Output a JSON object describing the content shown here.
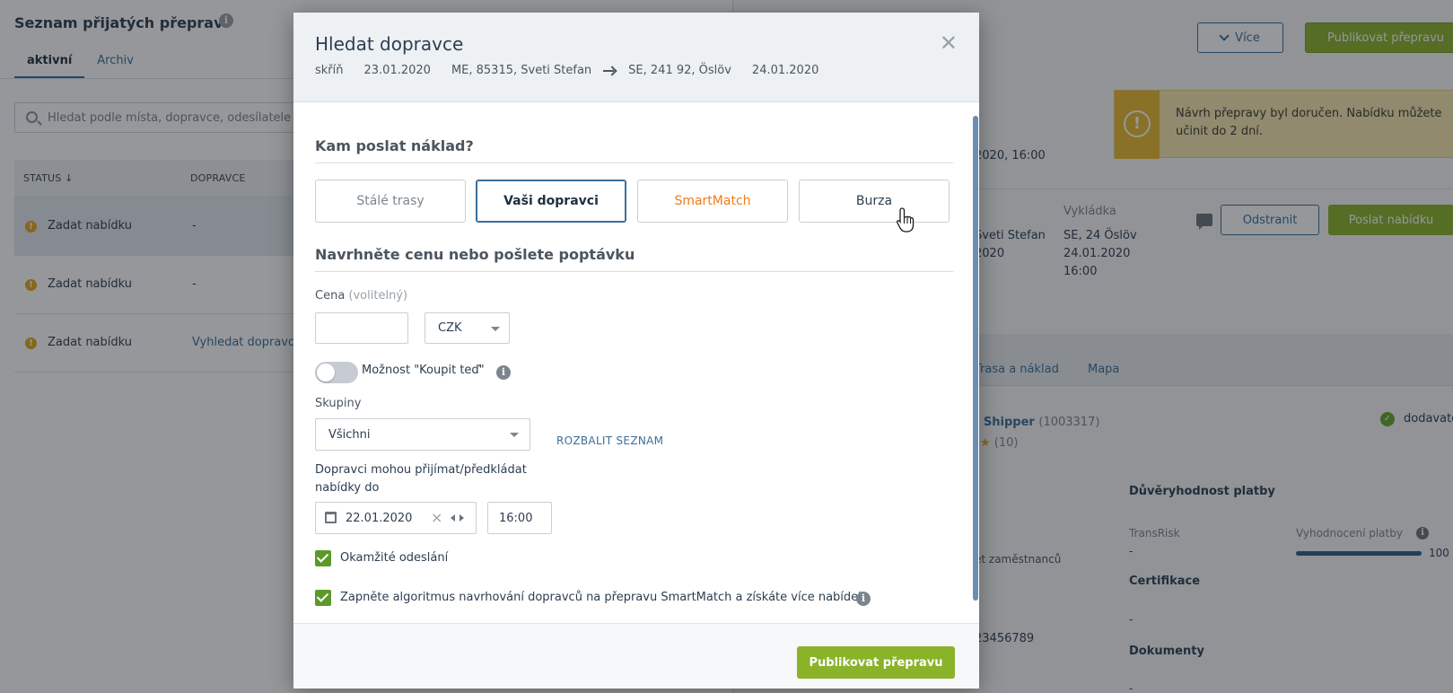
{
  "background": {
    "list": {
      "title": "Seznam přijatých přeprav",
      "tabs": [
        "aktivní",
        "Archiv"
      ],
      "search_placeholder": "Hledat podle místa, dopravce, odesílatele",
      "columns": {
        "status": "STATUS ↓",
        "carrier": "DOPRAVCE"
      },
      "rows": [
        {
          "status": "Zadat nabídku",
          "carrier": "-"
        },
        {
          "status": "Zadat nabídku",
          "carrier": "-"
        },
        {
          "status": "Zadat nabídku",
          "carrier": "Vyhledat dopravce"
        }
      ]
    },
    "detail": {
      "more_label": "Více",
      "publish_label": "Publikovat přepravu",
      "alert_text": "Návrh přepravy byl doručen. Nabídku můžete učinit do 2 dní.",
      "loading_time": "2020, 16:00",
      "unloading_label": "Vykládka",
      "unloading_place": "SE, 24 Öslöv",
      "unloading_date": "24.01.2020",
      "unloading_time": "16:00",
      "loading_place": "Sveti Stefan",
      "loading_date": "2020",
      "remove_label": "Odstranit",
      "send_offer_label": "Poslat nabídku",
      "tabs": [
        "Trasa a náklad",
        "Mapa"
      ],
      "shipper_name": "- Shipper",
      "shipper_id": "(1003317)",
      "rating_count": "(10)",
      "supplier_label": "dodavatel",
      "payment_trust": "Důvěryhodnost platby",
      "transrisk_label": "TransRisk",
      "transrisk_value": "-",
      "payment_eval_label": "Vyhodnocení platby",
      "payment_eval_value": "100",
      "payment_eval_percent": 100,
      "employees_label": "et zaměstnanců",
      "phone": "23456789",
      "certification_label": "Certifikace",
      "certification_value": "-",
      "documents_label": "Dokumenty",
      "documents_value": "-"
    }
  },
  "modal": {
    "title": "Hledat dopravce",
    "route": {
      "vehicle": "skříň",
      "load_date": "23.01.2020",
      "origin": "ME, 85315, Sveti Stefan",
      "destination": "SE, 241 92, Öslöv",
      "unload_date": "24.01.2020"
    },
    "where_title": "Kam poslat náklad?",
    "targets": [
      "Stálé trasy",
      "Vaši dopravci",
      "SmartMatch",
      "Burza"
    ],
    "selected_target": "Vaši dopravci",
    "price_section_title": "Navrhněte cenu nebo pošlete poptávku",
    "price_label": "Cena",
    "price_optional": "(volitelný)",
    "price_value": "",
    "currency": "CZK",
    "buy_now_label": "Možnost \"Koupit teď\"",
    "buy_now_enabled": false,
    "groups_label": "Skupiny",
    "groups_value": "Všichni",
    "expand_list": "ROZBALIT SEZNAM",
    "deadline_label": "Dopravci mohou přijímat/předkládat nabídky do",
    "deadline_date": "22.01.2020",
    "deadline_time": "16:00",
    "instant_send_label": "Okamžité odeslání",
    "instant_send_checked": true,
    "smartmatch_label": "Zapněte algoritmus navrhování dopravců na přepravu SmartMatch a získáte více nabídek.",
    "smartmatch_checked": true,
    "publish_label": "Publikovat přepravu"
  }
}
